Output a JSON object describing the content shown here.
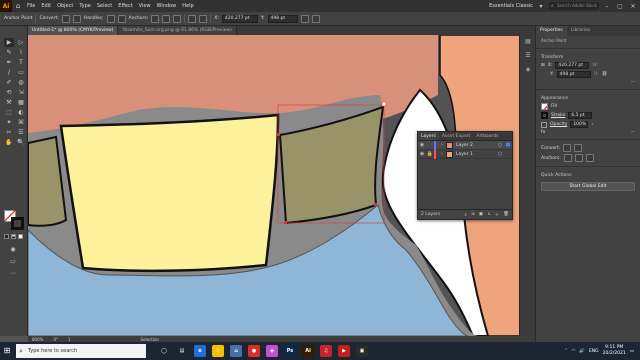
{
  "menubar": {
    "items": [
      "File",
      "Edit",
      "Object",
      "Type",
      "Select",
      "Effect",
      "View",
      "Window",
      "Help"
    ],
    "workspace": "Essentials Classic",
    "search_placeholder": "Search Adobe Stock",
    "logo": "Ai"
  },
  "controlbar": {
    "mode": "Anchor Point",
    "convert_label": "Convert:",
    "handles_label": "Handles:",
    "anchors_label": "Anchors:",
    "x_label": "X:",
    "x_value": "420.277 pt",
    "y_label": "Y:",
    "y_value": "498 pt"
  },
  "tabs": [
    {
      "label": "Untitled-1* @ 800% (CMYK/Preview)",
      "active": true
    },
    {
      "label": "Yosemite_Sam.org.png @ 61.86% (RGB/Preview)",
      "active": false
    }
  ],
  "tools": [
    "▶",
    "▷",
    "✎",
    "⌇",
    "✒",
    "T",
    "/",
    "▭",
    "✐",
    "◍",
    "⟲",
    "⇲",
    "⚒",
    "▦",
    "⬚",
    "◐",
    "✦",
    "⌘",
    "✂",
    "☰",
    "✋",
    "🔍"
  ],
  "properties": {
    "tabs": [
      "Properties",
      "Libraries"
    ],
    "selection_label": "Anchor Point",
    "transform_title": "Transform",
    "x_value": "420.277 pt",
    "y_value": "498 pt",
    "appearance_title": "Appearance",
    "fill_label": "Fill",
    "stroke_label": "Stroke",
    "stroke_value": "6.5 pt",
    "opacity_label": "Opacity",
    "opacity_value": "100%",
    "convert_label": "Convert:",
    "anchors_label": "Anchors:",
    "quick_actions_title": "Quick Actions",
    "quick_action_button": "Start Global Edit"
  },
  "layers": {
    "tabs": [
      "Layers",
      "Asset Export",
      "Artboards"
    ],
    "items": [
      {
        "name": "Layer 2",
        "color": "#4f7cff",
        "selected": true
      },
      {
        "name": "Layer 1",
        "color": "#ff4f4f",
        "selected": false
      }
    ],
    "count_label": "2 Layers"
  },
  "statusbar": {
    "zoom": "800%",
    "angle": "0°",
    "page": "1",
    "tool": "Selection"
  },
  "taskbar": {
    "search_placeholder": "Type here to search",
    "language": "ENG",
    "time": "9:11 PM",
    "date": "20/2/2021",
    "apps": [
      {
        "label": "◯",
        "color": "#1c2633"
      },
      {
        "label": "▤",
        "color": "#1c2633"
      },
      {
        "label": "e",
        "color": "#1f6fd6"
      },
      {
        "label": "▯",
        "color": "#f2c200"
      },
      {
        "label": "⌂",
        "color": "#4a6fa5"
      },
      {
        "label": "●",
        "color": "#d93025"
      },
      {
        "label": "◆",
        "color": "#c24fd6"
      },
      {
        "label": "Ps",
        "color": "#0e2a47"
      },
      {
        "label": "Ai",
        "color": "#331c00"
      },
      {
        "label": "♫",
        "color": "#c8242b"
      },
      {
        "label": "▶",
        "color": "#c41e1e"
      },
      {
        "label": "▣",
        "color": "#2b2b2b"
      }
    ]
  },
  "colors": {
    "salmon": "#d9907a",
    "olive": "#99936a",
    "yellow": "#fdf29b",
    "blue": "#8fb5d7",
    "orange": "#f0a47d",
    "gray": "#8a8a8a",
    "selection": "#e0353c"
  }
}
